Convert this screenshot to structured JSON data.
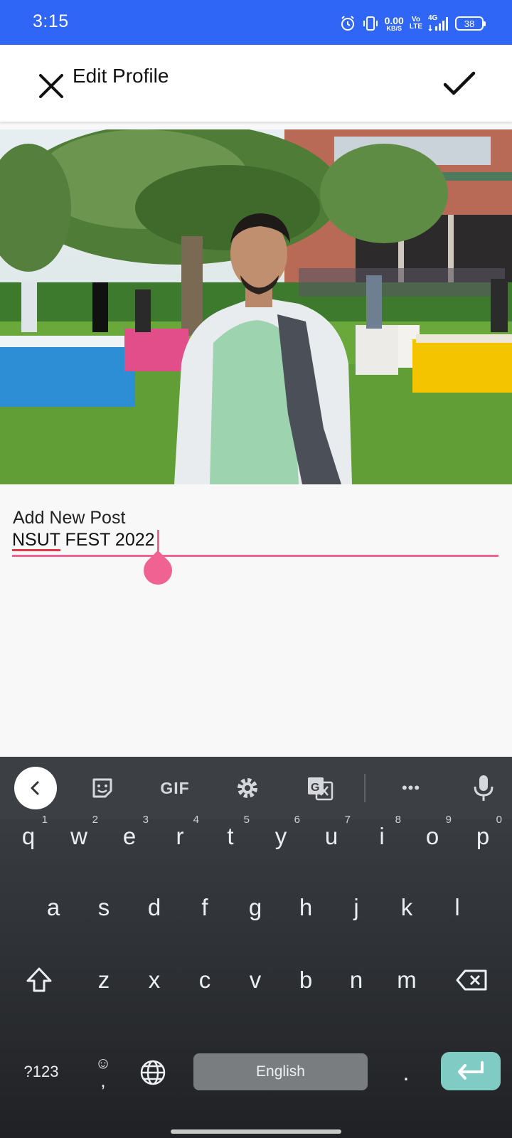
{
  "status_bar": {
    "time": "3:15",
    "net_speed_value": "0.00",
    "net_speed_unit": "KB/S",
    "volte_top": "Vo",
    "volte_bottom": "LTE",
    "network": "4G",
    "battery": "38",
    "icons": [
      "alarm-icon",
      "vibrate-icon",
      "signal-icon",
      "battery-icon"
    ]
  },
  "app_bar": {
    "title": "Edit Profile",
    "close_icon": "close-icon",
    "confirm_icon": "check-icon"
  },
  "form": {
    "label": "Add New Post",
    "value": "NSUT FEST 2022",
    "accent_color": "#f06292"
  },
  "keyboard": {
    "toolbar_icons": [
      "back-icon",
      "sticker-icon",
      "gif",
      "settings-icon",
      "translate-icon",
      "more-icon",
      "mic-icon"
    ],
    "gif_label": "GIF",
    "more_label": "•••",
    "row1": [
      {
        "letter": "q",
        "hint": "1"
      },
      {
        "letter": "w",
        "hint": "2"
      },
      {
        "letter": "e",
        "hint": "3"
      },
      {
        "letter": "r",
        "hint": "4"
      },
      {
        "letter": "t",
        "hint": "5"
      },
      {
        "letter": "y",
        "hint": "6"
      },
      {
        "letter": "u",
        "hint": "7"
      },
      {
        "letter": "i",
        "hint": "8"
      },
      {
        "letter": "o",
        "hint": "9"
      },
      {
        "letter": "p",
        "hint": "0"
      }
    ],
    "row2": [
      "a",
      "s",
      "d",
      "f",
      "g",
      "h",
      "j",
      "k",
      "l"
    ],
    "row3": [
      "z",
      "x",
      "c",
      "v",
      "b",
      "n",
      "m"
    ],
    "symbols_label": "?123",
    "emoji_top": "☺",
    "comma": ",",
    "space_label": "English",
    "period": ".",
    "enter_icon": "enter-icon",
    "shift_icon": "shift-icon",
    "backspace_icon": "backspace-icon",
    "globe_icon": "globe-icon"
  }
}
